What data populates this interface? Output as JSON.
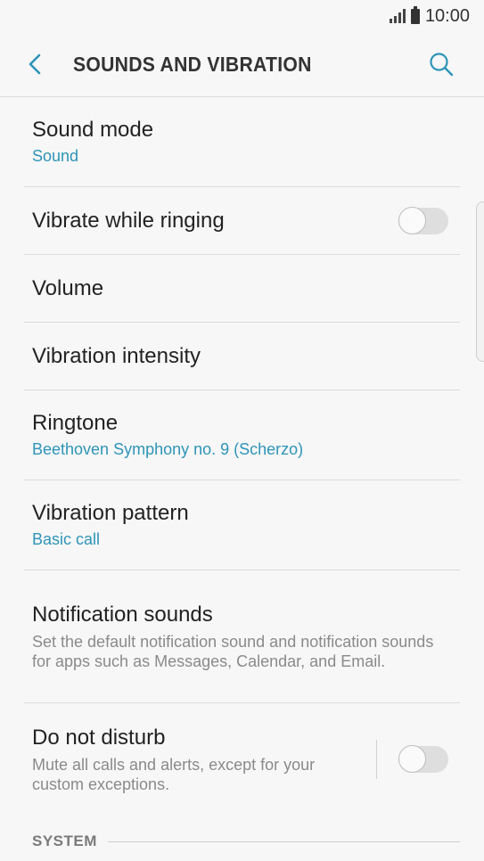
{
  "status_bar": {
    "time": "10:00"
  },
  "app_bar": {
    "title": "SOUNDS AND VIBRATION"
  },
  "items": {
    "sound_mode": {
      "label": "Sound mode",
      "value": "Sound"
    },
    "vibrate_while_ringing": {
      "label": "Vibrate while ringing",
      "enabled": false
    },
    "volume": {
      "label": "Volume"
    },
    "vibration_intensity": {
      "label": "Vibration intensity"
    },
    "ringtone": {
      "label": "Ringtone",
      "value": "Beethoven Symphony no. 9 (Scherzo)"
    },
    "vibration_pattern": {
      "label": "Vibration pattern",
      "value": "Basic call"
    },
    "notification_sounds": {
      "label": "Notification sounds",
      "description": "Set the default notification sound and notification sounds for apps such as Messages, Calendar, and Email."
    },
    "do_not_disturb": {
      "label": "Do not disturb",
      "description": "Mute all calls and alerts, except for your custom exceptions.",
      "enabled": false
    }
  },
  "section": {
    "label": "SYSTEM"
  },
  "colors": {
    "accent": "#2e94b7",
    "background": "#f7f7f7"
  }
}
